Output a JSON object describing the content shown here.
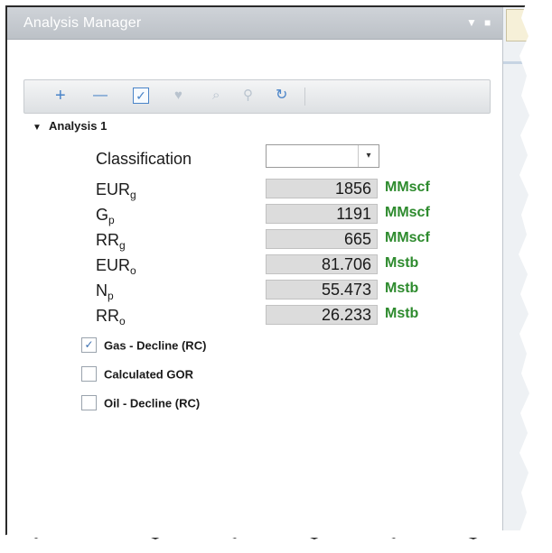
{
  "panel": {
    "title": "Analysis Manager",
    "title_icons": [
      "dropdown-arrow-icon",
      "pin-icon"
    ]
  },
  "toolbar": {
    "add_label": "+",
    "remove_label": "—",
    "icons": [
      "add-icon",
      "remove-icon",
      "check-all-icon",
      "heart-icon",
      "search-doc-icon",
      "refresh-icon"
    ]
  },
  "tree": {
    "analysis_label": "Analysis 1"
  },
  "classification": {
    "label": "Classification",
    "value": ""
  },
  "metrics": [
    {
      "name": "EUR",
      "sub": "g",
      "value": "1856",
      "unit": "MMscf"
    },
    {
      "name": "G",
      "sub": "p",
      "value": "1191",
      "unit": "MMscf"
    },
    {
      "name": "RR",
      "sub": "g",
      "value": "665",
      "unit": "MMscf"
    },
    {
      "name": "EUR",
      "sub": "o",
      "value": "81.706",
      "unit": "Mstb"
    },
    {
      "name": "N",
      "sub": "p",
      "value": "55.473",
      "unit": "Mstb"
    },
    {
      "name": "RR",
      "sub": "o",
      "value": "26.233",
      "unit": "Mstb"
    }
  ],
  "checkboxes": [
    {
      "label": "Gas - Decline (RC)",
      "checked": true
    },
    {
      "label": "Calculated GOR",
      "checked": false
    },
    {
      "label": "Oil - Decline (RC)",
      "checked": false
    }
  ],
  "colors": {
    "unit_green": "#2e8b2e",
    "toolbar_blue": "#4a84c8",
    "value_bg": "#dcdcdc"
  }
}
